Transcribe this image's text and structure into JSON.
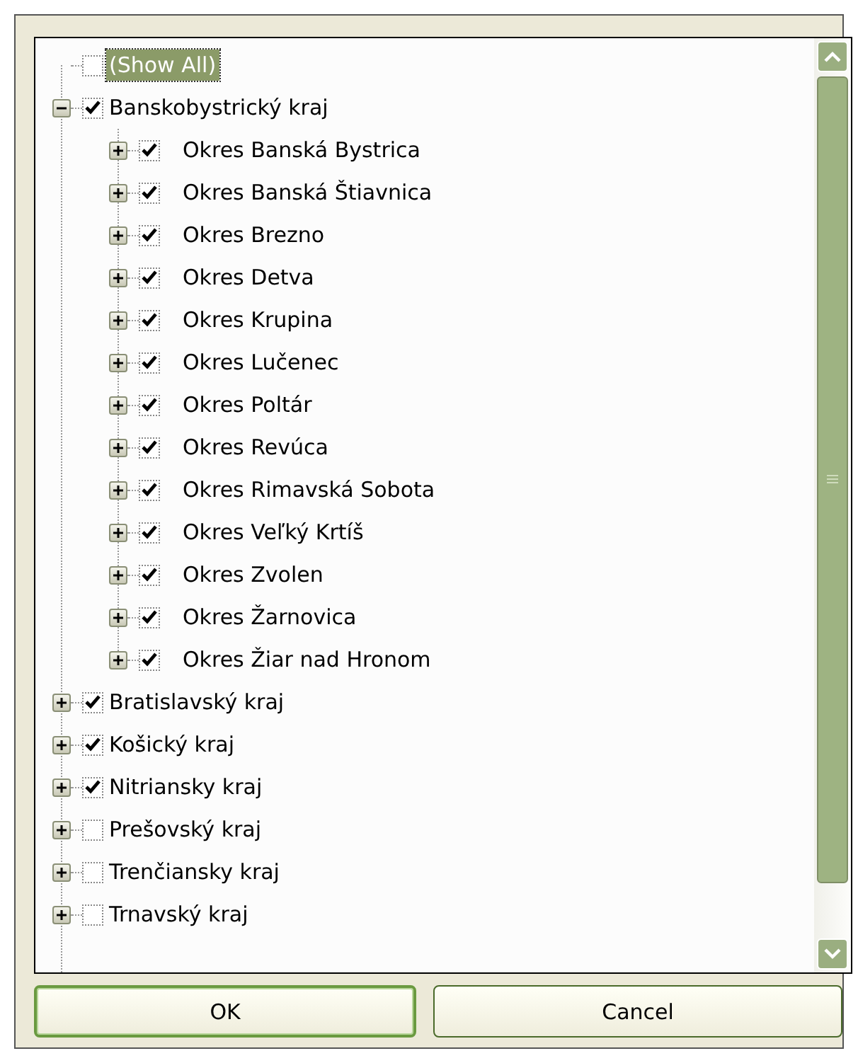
{
  "tree": [
    {
      "kind": "all",
      "label": "(Show All)",
      "checked": false,
      "selected": true
    },
    {
      "kind": "node",
      "label": "Banskobystrický kraj",
      "checked": true,
      "selected": false,
      "expanded": true,
      "children": [
        {
          "label": "Okres Banská Bystrica",
          "checked": true,
          "selected": false,
          "expanded": false
        },
        {
          "label": "Okres Banská Štiavnica",
          "checked": true,
          "selected": false,
          "expanded": false
        },
        {
          "label": "Okres Brezno",
          "checked": true,
          "selected": false,
          "expanded": false
        },
        {
          "label": "Okres Detva",
          "checked": true,
          "selected": false,
          "expanded": false
        },
        {
          "label": "Okres Krupina",
          "checked": true,
          "selected": false,
          "expanded": false
        },
        {
          "label": "Okres Lučenec",
          "checked": true,
          "selected": false,
          "expanded": false
        },
        {
          "label": "Okres Poltár",
          "checked": true,
          "selected": false,
          "expanded": false
        },
        {
          "label": "Okres Revúca",
          "checked": true,
          "selected": false,
          "expanded": false
        },
        {
          "label": "Okres Rimavská Sobota",
          "checked": true,
          "selected": false,
          "expanded": false
        },
        {
          "label": "Okres Veľký Krtíš",
          "checked": true,
          "selected": false,
          "expanded": false
        },
        {
          "label": "Okres Zvolen",
          "checked": true,
          "selected": false,
          "expanded": false
        },
        {
          "label": "Okres Žarnovica",
          "checked": true,
          "selected": false,
          "expanded": false
        },
        {
          "label": "Okres Žiar nad Hronom",
          "checked": true,
          "selected": false,
          "expanded": false
        }
      ]
    },
    {
      "kind": "node",
      "label": "Bratislavský kraj",
      "checked": true,
      "selected": false,
      "expanded": false
    },
    {
      "kind": "node",
      "label": "Košický kraj",
      "checked": true,
      "selected": false,
      "expanded": false
    },
    {
      "kind": "node",
      "label": "Nitriansky kraj",
      "checked": true,
      "selected": false,
      "expanded": false
    },
    {
      "kind": "node",
      "label": "Prešovský kraj",
      "checked": false,
      "selected": false,
      "expanded": false
    },
    {
      "kind": "node",
      "label": "Trenčiansky kraj",
      "checked": false,
      "selected": false,
      "expanded": false
    },
    {
      "kind": "node",
      "label": "Trnavský kraj",
      "checked": false,
      "selected": false,
      "expanded": false
    }
  ],
  "buttons": [
    {
      "label": "OK",
      "default": true
    },
    {
      "label": "Cancel",
      "default": false
    }
  ]
}
